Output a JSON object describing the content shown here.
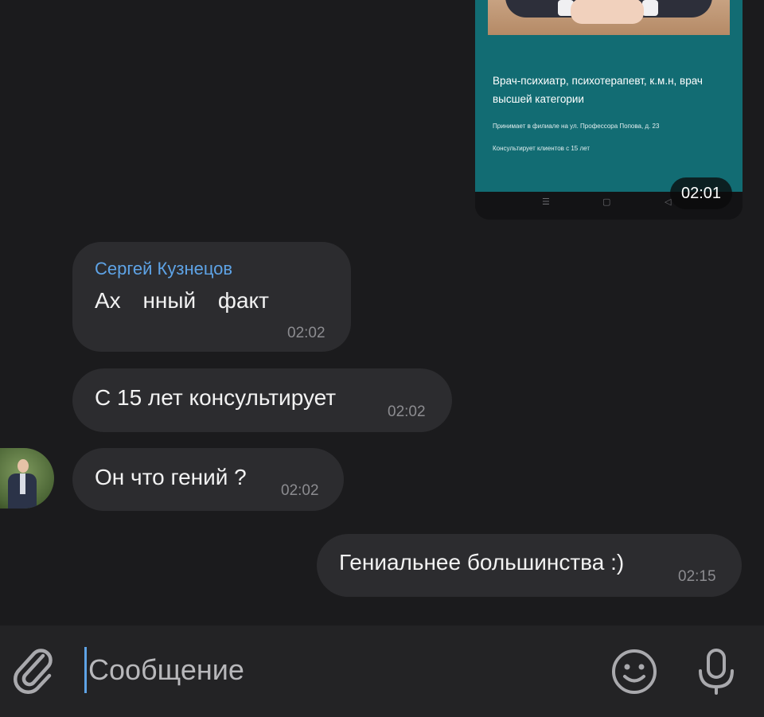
{
  "image_message": {
    "title": "Врач-психиатр, психотерапевт, к.м.н, врач высшей категории",
    "line1": "Принимает в филиале на ул. Профессора Попова, д. 23",
    "line2": "Консультирует клиентов с 15 лет",
    "time": "02:01",
    "nav_icons": [
      "menu-icon",
      "home-icon",
      "back-icon"
    ]
  },
  "messages": [
    {
      "sender": "Сергей Кузнецов",
      "text": "Ах нный факт",
      "time": "02:02"
    },
    {
      "text": "С 15 лет консультирует",
      "time": "02:02"
    },
    {
      "text": "Он что гений ?",
      "time": "02:02"
    },
    {
      "text": "Гениальнее большинства :)",
      "time": "02:15",
      "outgoing": true
    }
  ],
  "composer": {
    "placeholder": "Сообщение",
    "icons": [
      "paperclip-icon",
      "smiley-icon",
      "microphone-icon"
    ]
  },
  "colors": {
    "background": "#1b1b1d",
    "bubble": "#2c2c2f",
    "sender": "#5ea3e6",
    "image_card": "#126c73",
    "composer": "#232325"
  }
}
